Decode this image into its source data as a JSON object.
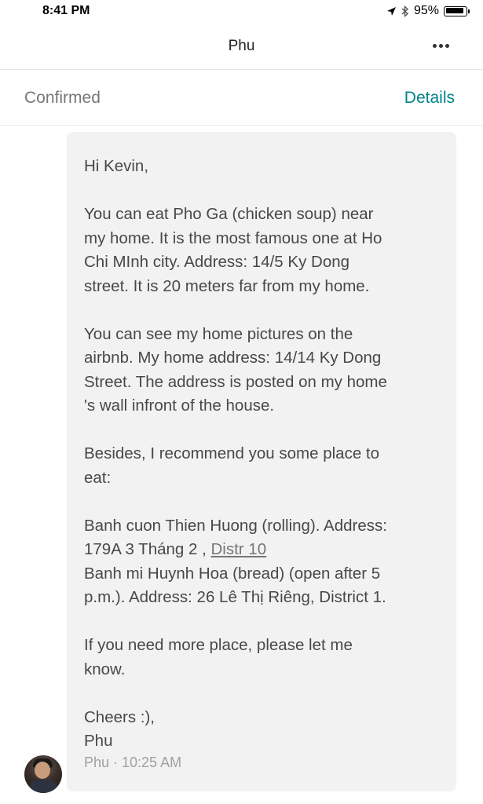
{
  "status_bar": {
    "time": "8:41 PM",
    "battery": "95%",
    "battery_level": 0.95,
    "icons": [
      "location-arrow-icon",
      "bluetooth-icon",
      "battery-icon"
    ]
  },
  "nav": {
    "title": "Phu",
    "more_icon": "more-horizontal-icon"
  },
  "reservation": {
    "status": "Confirmed",
    "details_label": "Details"
  },
  "message": {
    "greeting": "Hi Kevin,",
    "p1": [
      "You can eat Pho Ga (chicken soup) near",
      "my home. It is the most famous one at Ho",
      "Chi MInh city. Address: 14/5 Ky Dong",
      "street. It is 20 meters far  from my home."
    ],
    "p2": [
      "You can see my home pictures on the",
      "airbnb. My home address: 14/14 Ky Dong",
      "Street. The address is posted on my home",
      "'s wall infront of the house."
    ],
    "p3": [
      "Besides, I recommend you some place to",
      "eat:"
    ],
    "p4_line1": "Banh cuon Thien Huong (rolling). Address:",
    "p4_line2_text": "179A 3 Tháng 2 , ",
    "p4_link": "Distr 10",
    "p4_line3": "Banh mi Huynh Hoa (bread) (open after 5",
    "p4_line4": "p.m.). Address: 26 Lê Thị Riêng, District 1.",
    "p5": [
      "If you need more place, please let me",
      "know."
    ],
    "signoff": [
      "Cheers :),",
      "Phu"
    ],
    "meta": "Phu · 10:25 AM"
  },
  "colors": {
    "accent": "#00848a",
    "bubble": "#f2f2f2",
    "text": "#484848",
    "muted": "#767676"
  }
}
